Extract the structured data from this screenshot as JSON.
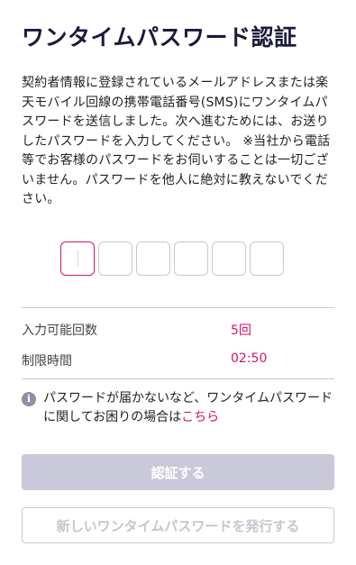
{
  "title": "ワンタイムパスワード認証",
  "description": "契約者情報に登録されているメールアドレスまたは楽天モバイル回線の携帯電話番号(SMS)にワンタイムパスワードを送信しました。次へ進むためには、お送りしたパスワードを入力してください。 ※当社から電話等でお客様のパスワードをお伺いすることは一切ございません。パスワードを他人に絶対に教えないでください。",
  "otp": {
    "digits": [
      "",
      "",
      "",
      "",
      "",
      ""
    ]
  },
  "info": {
    "attempts_label": "入力可能回数",
    "attempts_value": "5回",
    "time_label": "制限時間",
    "time_value": "02:50"
  },
  "help": {
    "icon": "info-icon",
    "icon_glyph": "i",
    "text": "パスワードが届かないなど、ワンタイムパスワードに関してお困りの場合は",
    "link_text": "こちら"
  },
  "buttons": {
    "verify_label": "認証する",
    "resend_label": "新しいワンタイムパスワードを発行する"
  },
  "colors": {
    "accent": "#d4146e",
    "title": "#1a1a3c",
    "disabled_button": "#c9c9d9"
  }
}
